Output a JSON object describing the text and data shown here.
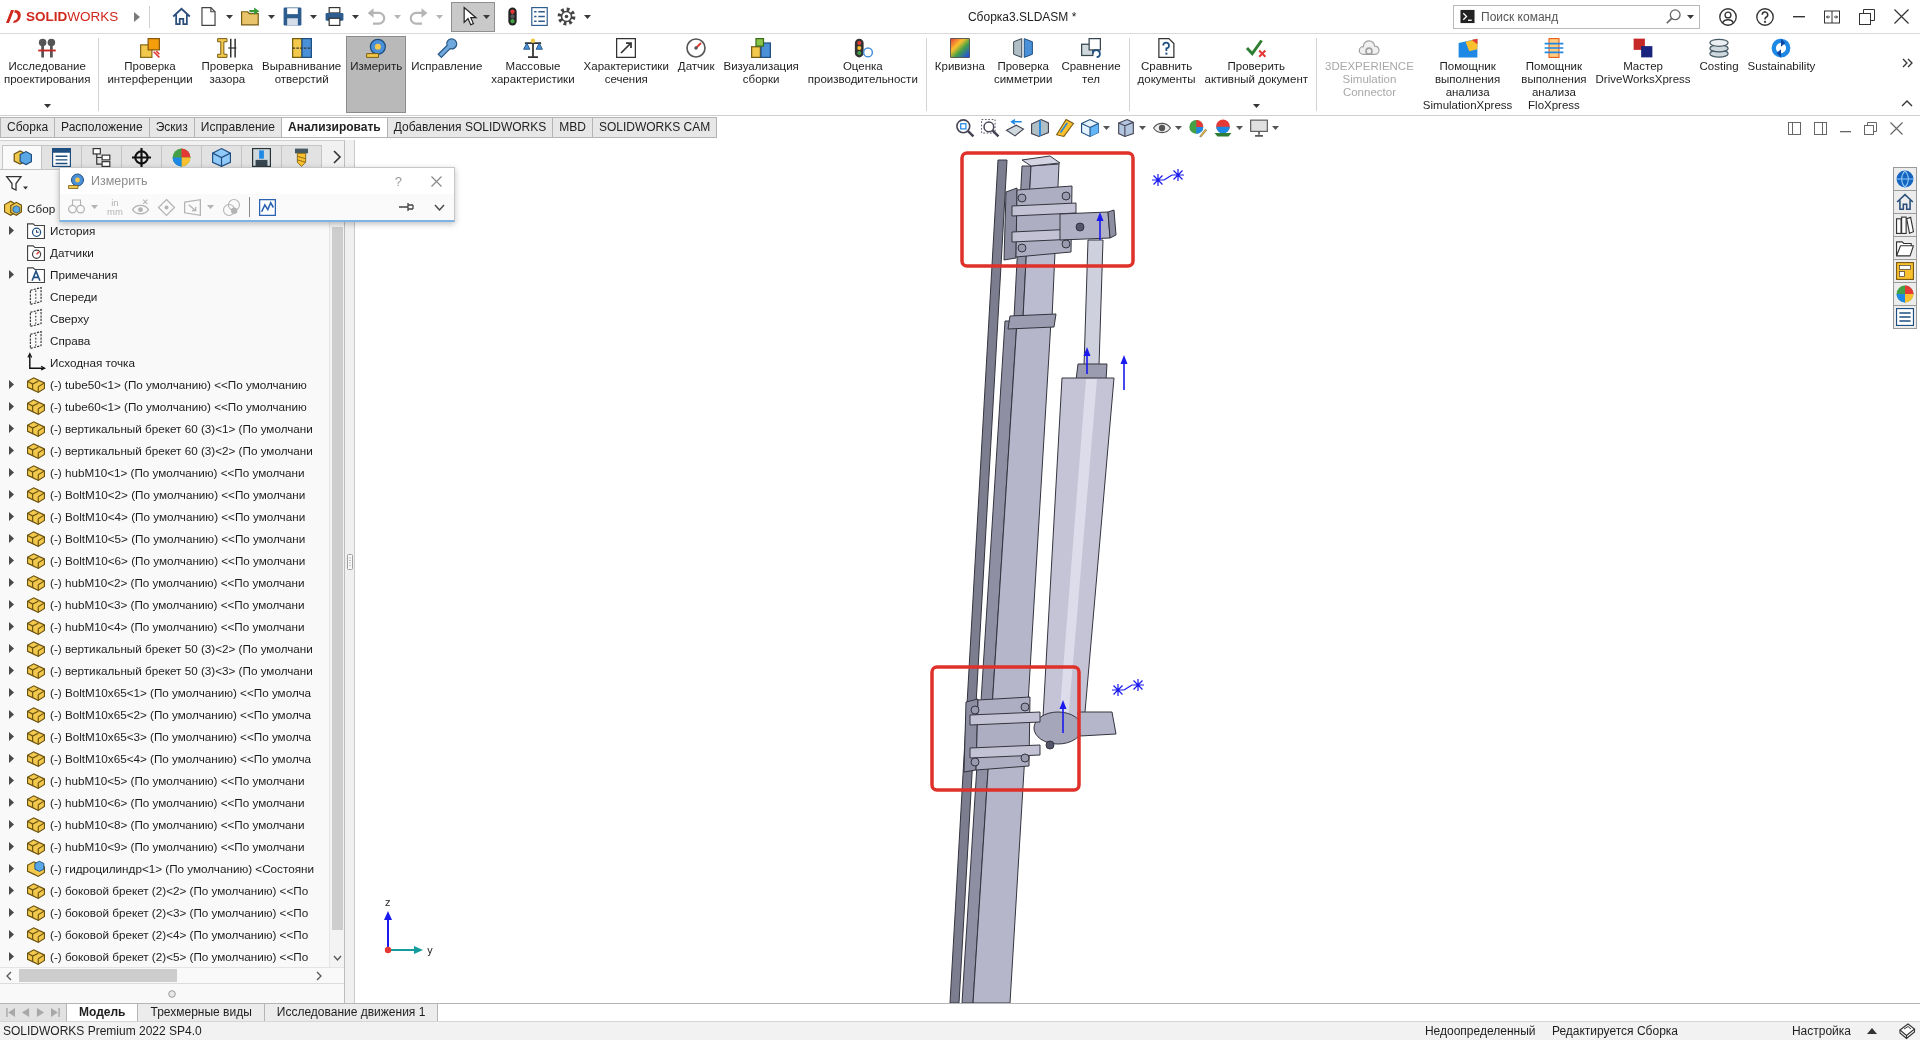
{
  "title_bar": {
    "logo": "**SOLID**WORKS",
    "quick_access": [
      {
        "kind": "home",
        "pressed": false,
        "disabled": false
      },
      {
        "kind": "new",
        "caret": true,
        "pressed": false,
        "disabled": false
      },
      {
        "kind": "open",
        "caret": true,
        "pressed": false,
        "disabled": false
      },
      {
        "kind": "save",
        "caret": true,
        "pressed": false,
        "disabled": false
      },
      {
        "kind": "print",
        "caret": true,
        "pressed": false,
        "disabled": false
      },
      {
        "kind": "undo",
        "caret": true,
        "pressed": false,
        "disabled": true
      },
      {
        "kind": "redo",
        "caret": true,
        "pressed": false,
        "disabled": true
      },
      {
        "kind": "select",
        "caret": true,
        "pressed": true,
        "disabled": false
      },
      {
        "kind": "rebuild",
        "pressed": false,
        "disabled": false
      },
      {
        "kind": "file_properties",
        "pressed": false,
        "disabled": false
      },
      {
        "kind": "options",
        "caret": true,
        "pressed": false,
        "disabled": false
      }
    ],
    "document_title": "Сборка3.SLDASM *",
    "search": {
      "placeholder": "Поиск команд"
    }
  },
  "ribbon": {
    "groups": [
      [
        {
          "kind": "design_study",
          "lines": [
            "Исследование",
            "проектирования"
          ],
          "caret": true,
          "selected": false,
          "disabled": false
        }
      ],
      [
        {
          "kind": "interference",
          "lines": [
            "Проверка",
            "интерференции"
          ],
          "selected": false,
          "disabled": false
        },
        {
          "kind": "clearance",
          "lines": [
            "Проверка",
            "зазора"
          ],
          "selected": false,
          "disabled": false
        },
        {
          "kind": "hole_alignment",
          "lines": [
            "Выравнивание",
            "отверстий"
          ],
          "selected": false,
          "disabled": false
        },
        {
          "kind": "measure",
          "lines": [
            "Измерить"
          ],
          "selected": true,
          "disabled": false
        },
        {
          "kind": "fix",
          "lines": [
            "Исправление"
          ],
          "selected": false,
          "disabled": false
        },
        {
          "kind": "mass",
          "lines": [
            "Массовые",
            "характеристики"
          ],
          "selected": false,
          "disabled": false
        },
        {
          "kind": "section",
          "lines": [
            "Характеристики",
            "сечения"
          ],
          "selected": false,
          "disabled": false
        },
        {
          "kind": "sensor",
          "lines": [
            "Датчик"
          ],
          "selected": false,
          "disabled": false
        },
        {
          "kind": "visualization",
          "lines": [
            "Визуализация",
            "сборки"
          ],
          "selected": false,
          "disabled": false
        },
        {
          "kind": "performance",
          "lines": [
            "Оценка",
            "производительности"
          ],
          "selected": false,
          "disabled": false
        }
      ],
      [
        {
          "kind": "curvature",
          "lines": [
            "Кривизна"
          ],
          "selected": false,
          "disabled": false
        },
        {
          "kind": "symmetry",
          "lines": [
            "Проверка",
            "симметрии"
          ],
          "selected": false,
          "disabled": false
        },
        {
          "kind": "compare_bodies",
          "lines": [
            "Сравнение",
            "тел"
          ],
          "selected": false,
          "disabled": false
        }
      ],
      [
        {
          "kind": "compare_documents",
          "lines": [
            "Сравнить",
            "документы"
          ],
          "selected": false,
          "disabled": false
        },
        {
          "kind": "check_document",
          "lines": [
            "Проверить",
            "активный документ"
          ],
          "caret": true,
          "selected": false,
          "disabled": false
        }
      ],
      [
        {
          "kind": "sim_connector",
          "lines": [
            "3DEXPERIENCE",
            "Simulation",
            "Connector"
          ],
          "selected": false,
          "disabled": true
        },
        {
          "kind": "simxpress",
          "lines": [
            "Помощник",
            "выполнения",
            "анализа",
            "SimulationXpress"
          ],
          "selected": false,
          "disabled": false
        },
        {
          "kind": "floxpress",
          "lines": [
            "Помощник",
            "выполнения",
            "анализа",
            "FloXpress"
          ],
          "selected": false,
          "disabled": false
        },
        {
          "kind": "driveworks",
          "lines": [
            "Мастер",
            "DriveWorksXpress"
          ],
          "selected": false,
          "disabled": false
        },
        {
          "kind": "costing",
          "lines": [
            "Costing"
          ],
          "selected": false,
          "disabled": false
        },
        {
          "kind": "sustainability",
          "lines": [
            "Sustainability"
          ],
          "selected": false,
          "disabled": false
        }
      ]
    ]
  },
  "command_tabs": [
    {
      "label": "Сборка",
      "selected": false
    },
    {
      "label": "Расположение",
      "selected": false
    },
    {
      "label": "Эскиз",
      "selected": false
    },
    {
      "label": "Исправление",
      "selected": false
    },
    {
      "label": "Анализировать",
      "selected": true
    },
    {
      "label": "Добавления SOLIDWORKS",
      "selected": false
    },
    {
      "label": "MBD",
      "selected": false
    },
    {
      "label": "SOLIDWORKS CAM",
      "selected": false
    }
  ],
  "view_toolbar": [
    {
      "kind": "zoom_fit"
    },
    {
      "kind": "zoom_area"
    },
    {
      "kind": "previous_view"
    },
    {
      "kind": "section_view"
    },
    {
      "kind": "dynamic_annotation"
    },
    {
      "kind": "view_orientation",
      "caret": true
    },
    {
      "kind": "display_style",
      "caret": true
    },
    {
      "kind": "hide_show",
      "caret": true
    },
    {
      "kind": "edit_appearance"
    },
    {
      "kind": "apply_scene",
      "caret": true
    },
    {
      "kind": "view_settings",
      "caret": true
    }
  ],
  "feature_panel": {
    "tabs": [
      {
        "kind": "feature_tree",
        "selected": true
      },
      {
        "kind": "property_manager",
        "selected": false
      },
      {
        "kind": "configuration_manager",
        "selected": false
      },
      {
        "kind": "dimxpert",
        "selected": false
      },
      {
        "kind": "display_manager",
        "selected": false
      },
      {
        "kind": "cam_feature",
        "selected": false
      },
      {
        "kind": "cam_operation",
        "selected": false
      },
      {
        "kind": "cam_tool",
        "selected": false
      }
    ],
    "tree": {
      "label": "Сбор",
      "kind": "assembly",
      "expander": false,
      "children": [
        {
          "label": "История",
          "kind": "history_folder",
          "expander": true,
          "expanded": false
        },
        {
          "label": "Датчики",
          "kind": "sensor_folder",
          "expander": false
        },
        {
          "label": "Примечания",
          "kind": "annotation_folder",
          "expander": true,
          "expanded": false
        },
        {
          "label": "Спереди",
          "kind": "plane",
          "expander": false
        },
        {
          "label": "Сверху",
          "kind": "plane",
          "expander": false
        },
        {
          "label": "Справа",
          "kind": "plane",
          "expander": false
        },
        {
          "label": "Исходная точка",
          "kind": "origin",
          "expander": false
        },
        {
          "label": "(-) tube50<1> (По умолчанию) <<По умолчанию",
          "kind": "part",
          "expander": true,
          "expanded": false
        },
        {
          "label": "(-) tube60<1> (По умолчанию) <<По умолчанию",
          "kind": "part",
          "expander": true,
          "expanded": false
        },
        {
          "label": "(-) вертикальный брекет 60 (3)<1> (По умолчани",
          "kind": "part",
          "expander": true,
          "expanded": false
        },
        {
          "label": "(-) вертикальный брекет 60 (3)<2> (По умолчани",
          "kind": "part",
          "expander": true,
          "expanded": false
        },
        {
          "label": "(-) hubM10<1> (По умолчанию) <<По умолчани",
          "kind": "part",
          "expander": true,
          "expanded": false
        },
        {
          "label": "(-) BoltM10<2> (По умолчанию) <<По умолчани",
          "kind": "part",
          "expander": true,
          "expanded": false
        },
        {
          "label": "(-) BoltM10<4> (По умолчанию) <<По умолчани",
          "kind": "part",
          "expander": true,
          "expanded": false
        },
        {
          "label": "(-) BoltM10<5> (По умолчанию) <<По умолчани",
          "kind": "part",
          "expander": true,
          "expanded": false
        },
        {
          "label": "(-) BoltM10<6> (По умолчанию) <<По умолчани",
          "kind": "part",
          "expander": true,
          "expanded": false
        },
        {
          "label": "(-) hubM10<2> (По умолчанию) <<По умолчани",
          "kind": "part",
          "expander": true,
          "expanded": false
        },
        {
          "label": "(-) hubM10<3> (По умолчанию) <<По умолчани",
          "kind": "part",
          "expander": true,
          "expanded": false
        },
        {
          "label": "(-) hubM10<4> (По умолчанию) <<По умолчани",
          "kind": "part",
          "expander": true,
          "expanded": false
        },
        {
          "label": "(-) вертикальный брекет 50 (3)<2> (По умолчани",
          "kind": "part",
          "expander": true,
          "expanded": false
        },
        {
          "label": "(-) вертикальный брекет 50 (3)<3> (По умолчани",
          "kind": "part",
          "expander": true,
          "expanded": false
        },
        {
          "label": "(-) BoltM10x65<1> (По умолчанию) <<По умолча",
          "kind": "part",
          "expander": true,
          "expanded": false
        },
        {
          "label": "(-) BoltM10x65<2> (По умолчанию) <<По умолча",
          "kind": "part",
          "expander": true,
          "expanded": false
        },
        {
          "label": "(-) BoltM10x65<3> (По умолчанию) <<По умолча",
          "kind": "part",
          "expander": true,
          "expanded": false
        },
        {
          "label": "(-) BoltM10x65<4> (По умолчанию) <<По умолча",
          "kind": "part",
          "expander": true,
          "expanded": false
        },
        {
          "label": "(-) hubM10<5> (По умолчанию) <<По умолчани",
          "kind": "part",
          "expander": true,
          "expanded": false
        },
        {
          "label": "(-) hubM10<6> (По умолчанию) <<По умолчани",
          "kind": "part",
          "expander": true,
          "expanded": false
        },
        {
          "label": "(-) hubM10<8> (По умолчанию) <<По умолчани",
          "kind": "part",
          "expander": true,
          "expanded": false
        },
        {
          "label": "(-) hubM10<9> (По умолчанию) <<По умолчани",
          "kind": "part",
          "expander": true,
          "expanded": false
        },
        {
          "label": "(-) гидроцилиндр<1> (По умолчанию) <Состояни",
          "kind": "subassembly",
          "expander": true,
          "expanded": false
        },
        {
          "label": "(-) боковой брекет (2)<2> (По умолчанию) <<По",
          "kind": "part",
          "expander": true,
          "expanded": false
        },
        {
          "label": "(-) боковой брекет (2)<3> (По умолчанию) <<По",
          "kind": "part",
          "expander": true,
          "expanded": false
        },
        {
          "label": "(-) боковой брекет (2)<4> (По умолчанию) <<По",
          "kind": "part",
          "expander": true,
          "expanded": false
        },
        {
          "label": "(-) боковой брекет (2)<5> (По умолчанию) <<По",
          "kind": "part",
          "expander": true,
          "expanded": false
        }
      ]
    }
  },
  "measure_dialog": {
    "title": "Измерить",
    "help": "?",
    "tool_groups": [
      [
        {
          "kind": "arc",
          "caret": true,
          "disabled": true
        },
        {
          "kind": "units",
          "lines": [
            "in",
            "mm"
          ],
          "disabled": true
        },
        {
          "kind": "xyz",
          "disabled": true
        },
        {
          "kind": "point",
          "disabled": true
        },
        {
          "kind": "projection",
          "caret": true,
          "disabled": true
        },
        {
          "kind": "history",
          "disabled": true
        }
      ],
      [
        {
          "kind": "sensor",
          "disabled": false
        }
      ]
    ]
  },
  "graphics": {
    "triad_labels": [
      "z",
      "y"
    ]
  },
  "task_pane": [
    {
      "kind": "resources"
    },
    {
      "kind": "home"
    },
    {
      "kind": "design_library"
    },
    {
      "kind": "file_explorer"
    },
    {
      "kind": "view_palette"
    },
    {
      "kind": "appearances"
    },
    {
      "kind": "custom_properties"
    }
  ],
  "bottom_tabs": {
    "nav": [
      {
        "kind": "first",
        "disabled": true
      },
      {
        "kind": "previous",
        "disabled": true
      },
      {
        "kind": "next",
        "disabled": true
      },
      {
        "kind": "last",
        "disabled": true
      }
    ],
    "tabs": [
      {
        "label": "Модель",
        "selected": true
      },
      {
        "label": "Трехмерные виды",
        "selected": false
      },
      {
        "label": "Исследование движения 1",
        "selected": false
      }
    ]
  },
  "status_bar": {
    "product": "SOLIDWORKS Premium 2022 SP4.0",
    "fields": [
      "Недоопределенный",
      "Редактируется Сборка",
      "Настройка"
    ]
  }
}
